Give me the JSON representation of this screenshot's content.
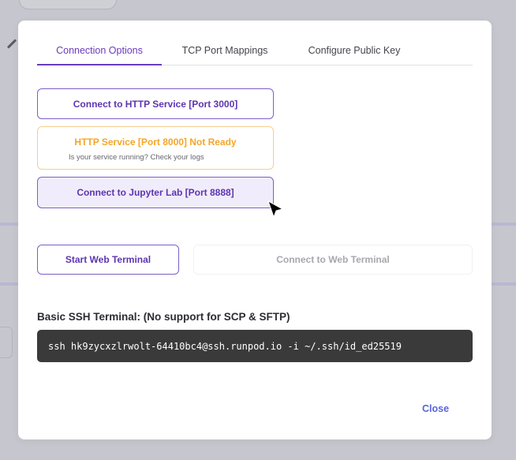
{
  "tabs": [
    {
      "label": "Connection Options"
    },
    {
      "label": "TCP Port Mappings"
    },
    {
      "label": "Configure Public Key"
    }
  ],
  "connect": {
    "http_3000": "Connect to HTTP Service [Port 3000]",
    "http_8000_title": "HTTP Service [Port 8000] Not Ready",
    "http_8000_sub": "Is your service running? Check your logs",
    "jupyter": "Connect to Jupyter Lab [Port 8888]",
    "start_terminal": "Start Web Terminal",
    "connect_terminal": "Connect to Web Terminal"
  },
  "ssh": {
    "label": "Basic SSH Terminal: (No support for SCP & SFTP)",
    "command": "ssh hk9zycxzlrwolt-64410bc4@ssh.runpod.io -i ~/.ssh/id_ed25519"
  },
  "footer": {
    "close_label": "Close"
  },
  "colors": {
    "accent": "#6a3cc1",
    "warning": "#f4a62a",
    "link": "#5a63d8",
    "terminal_bg": "#3a3a3a"
  }
}
